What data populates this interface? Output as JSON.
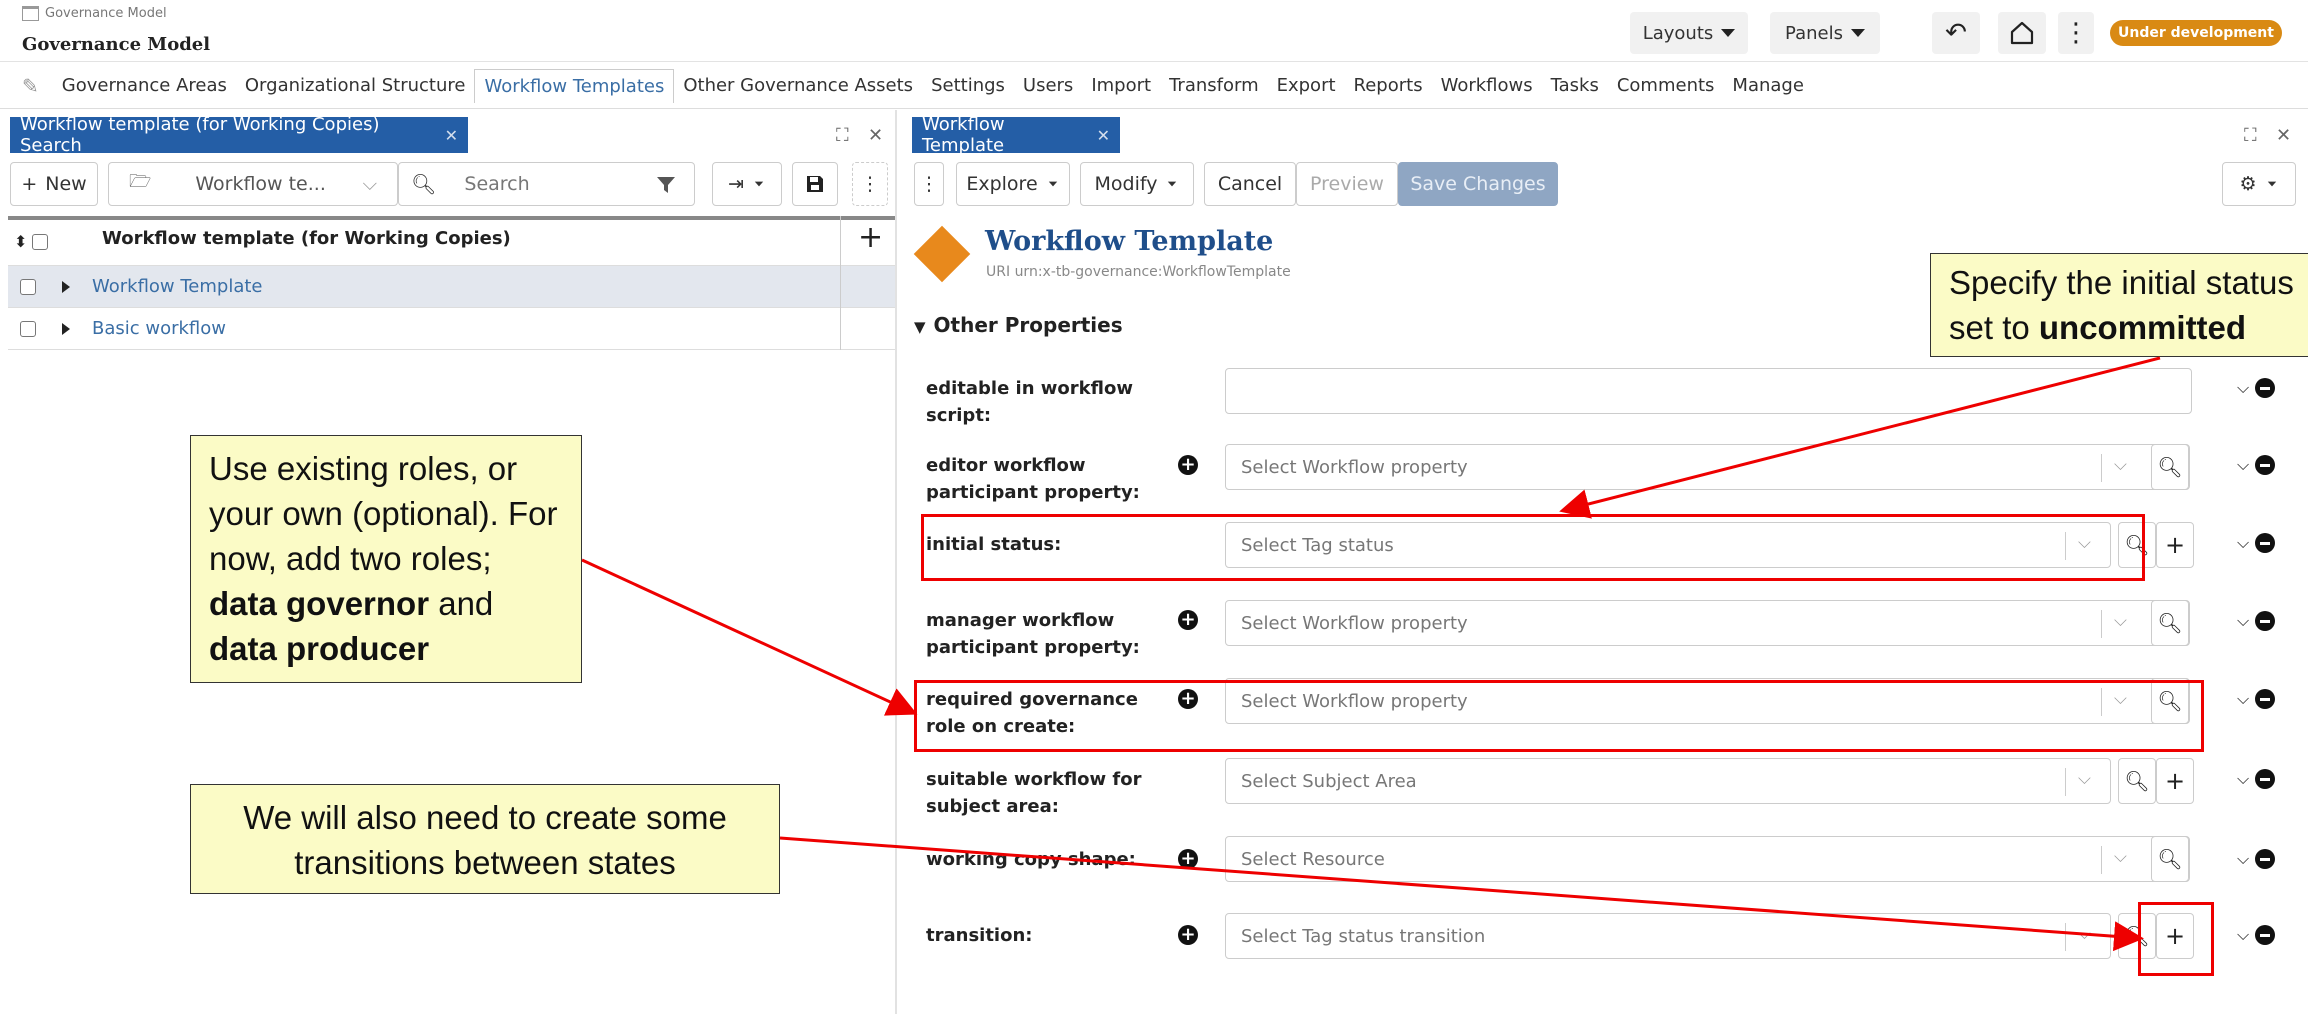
{
  "app": {
    "small_label": "Governance Model",
    "title": "Governance Model"
  },
  "topbar": {
    "layouts": "Layouts",
    "panels": "Panels",
    "badge": "Under development"
  },
  "menu": [
    "Governance Areas",
    "Organizational Structure",
    "Workflow Templates",
    "Other Governance Assets",
    "Settings",
    "Users",
    "Import",
    "Transform",
    "Export",
    "Reports",
    "Workflows",
    "Tasks",
    "Comments",
    "Manage"
  ],
  "left_panel": {
    "tab": "Workflow template (for Working Copies) Search",
    "new_btn": "New",
    "type_select": "Workflow te...",
    "search_placeholder": "Search",
    "column_header": "Workflow template (for Working Copies)",
    "rows": [
      "Workflow Template",
      "Basic workflow"
    ]
  },
  "right_panel": {
    "tab": "Workflow Template",
    "toolbar": {
      "explore": "Explore",
      "modify": "Modify",
      "cancel": "Cancel",
      "preview": "Preview",
      "save": "Save Changes"
    },
    "resource_title": "Workflow Template",
    "uri_label": "URI",
    "uri": "urn:x-tb-governance:WorkflowTemplate",
    "section": "Other Properties",
    "properties": [
      {
        "label": "editable in workflow script:",
        "placeholder": ""
      },
      {
        "label": "editor workflow participant property:",
        "placeholder": "Select Workflow property"
      },
      {
        "label": "initial status:",
        "placeholder": "Select Tag status"
      },
      {
        "label": "manager workflow participant property:",
        "placeholder": "Select Workflow property"
      },
      {
        "label": "required governance role on create:",
        "placeholder": "Select Workflow property"
      },
      {
        "label": "suitable workflow for subject area:",
        "placeholder": "Select Subject Area"
      },
      {
        "label": "working copy shape:",
        "placeholder": "Select Resource"
      },
      {
        "label": "transition:",
        "placeholder": "Select Tag status transition"
      }
    ]
  },
  "callouts": {
    "roles_1": "Use existing roles, or your own (optional). For now, add two roles;",
    "roles_bold_1": "data governor",
    "roles_and": "and",
    "roles_bold_2": "data producer",
    "transitions": "We will also need to create some transitions between states",
    "status_1": "Specify the initial status",
    "status_2": "set to",
    "status_bold": "uncommitted"
  },
  "colors": {
    "tab_blue": "#245ea6",
    "accent_orange": "#e8891c",
    "badge": "#d98a14",
    "callout_bg": "#fbfbc6",
    "highlight_red": "#e00000"
  }
}
